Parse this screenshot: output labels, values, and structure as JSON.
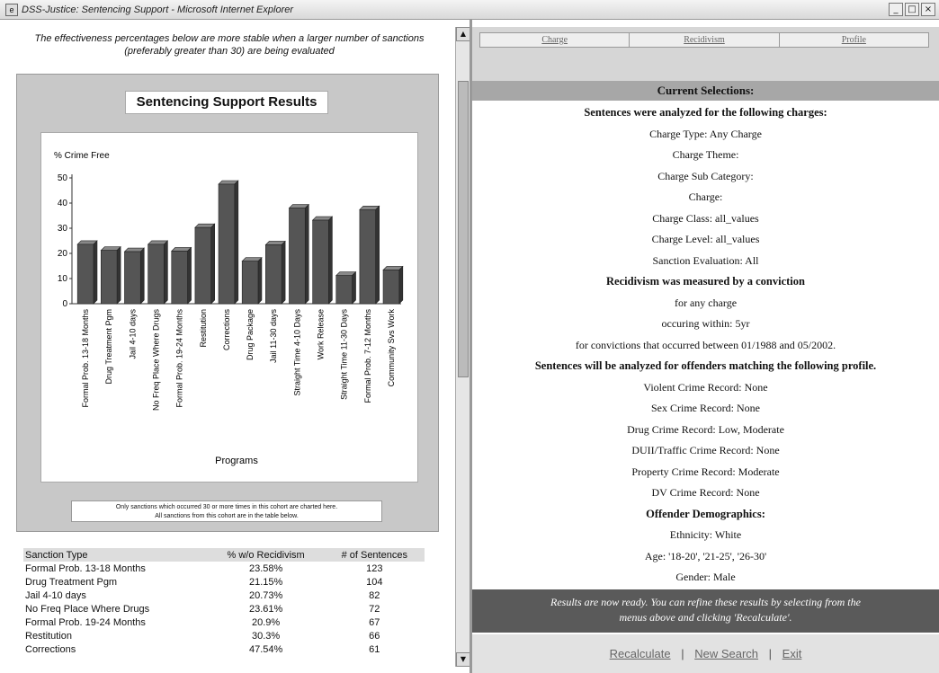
{
  "window": {
    "title": "DSS-Justice: Sentencing Support - Microsoft Internet Explorer",
    "minimize": "_",
    "restore": "□",
    "close": "×"
  },
  "left": {
    "note": "The effectiveness percentages below are more stable when a larger number of sanctions (preferably greater than 30) are being evaluated",
    "chart_footnote_line1": "Only sanctions which occurred 30 or more times in this cohort are charted here.",
    "chart_footnote_line2": "All sanctions from this cohort are in the table below."
  },
  "chart_data": {
    "type": "bar",
    "title": "Sentencing Support Results",
    "ylabel": "% Crime Free",
    "xlabel": "Programs",
    "ylim": [
      0,
      50
    ],
    "yticks": [
      0,
      10,
      20,
      30,
      40,
      50
    ],
    "grid": false,
    "categories": [
      "Formal Prob. 13-18 Months",
      "Drug Treatment Pgm",
      "Jail 4-10 days",
      "No Freq Place Where Drugs",
      "Formal Prob. 19-24 Months",
      "Restitution",
      "Corrections",
      "Drug Package",
      "Jail 11-30 days",
      "Straight Time 4-10 Days",
      "Work Release",
      "Straight Time 11-30 Days",
      "Formal Prob. 7-12 Months",
      "Community Svs Work"
    ],
    "values": [
      23.6,
      21.2,
      20.7,
      23.6,
      20.9,
      30.3,
      47.5,
      16.9,
      23.4,
      38.0,
      33.2,
      11.2,
      37.4,
      13.4
    ],
    "bar_color": "#555555"
  },
  "table": {
    "headers": [
      "Sanction Type",
      "% w/o Recidivism",
      "# of Sentences"
    ],
    "rows": [
      [
        "Formal Prob. 13-18 Months",
        "23.58%",
        "123"
      ],
      [
        "Drug Treatment Pgm",
        "21.15%",
        "104"
      ],
      [
        "Jail 4-10 days",
        "20.73%",
        "82"
      ],
      [
        "No Freq Place Where Drugs",
        "23.61%",
        "72"
      ],
      [
        "Formal Prob. 19-24 Months",
        "20.9%",
        "67"
      ],
      [
        "Restitution",
        "30.3%",
        "66"
      ],
      [
        "Corrections",
        "47.54%",
        "61"
      ]
    ]
  },
  "right": {
    "tabs": [
      "Charge",
      "Recidivism",
      "Profile"
    ],
    "header": "Current Selections:",
    "lines": [
      {
        "text": "Sentences were analyzed for the following charges:",
        "bold": true
      },
      {
        "text": "Charge Type: Any Charge",
        "bold": false
      },
      {
        "text": "Charge Theme:",
        "bold": false
      },
      {
        "text": "Charge Sub Category:",
        "bold": false
      },
      {
        "text": "Charge:",
        "bold": false
      },
      {
        "text": "Charge Class: all_values",
        "bold": false
      },
      {
        "text": "Charge Level: all_values",
        "bold": false
      },
      {
        "text": "Sanction Evaluation: All",
        "bold": false
      },
      {
        "text": "Recidivism was measured by a conviction",
        "bold": true
      },
      {
        "text": "for any charge",
        "bold": false
      },
      {
        "text": "occuring within: 5yr",
        "bold": false
      },
      {
        "text": "for convictions that occurred between 01/1988 and 05/2002.",
        "bold": false
      },
      {
        "text": "Sentences will be analyzed for offenders matching the following profile.",
        "bold": true
      },
      {
        "text": "Violent Crime Record: None",
        "bold": false
      },
      {
        "text": "Sex Crime Record: None",
        "bold": false
      },
      {
        "text": "Drug Crime Record: Low, Moderate",
        "bold": false
      },
      {
        "text": "DUII/Traffic Crime Record: None",
        "bold": false
      },
      {
        "text": "Property Crime Record: Moderate",
        "bold": false
      },
      {
        "text": "DV Crime Record: None",
        "bold": false
      },
      {
        "text": "Offender Demographics:",
        "bold": true
      },
      {
        "text": "Ethnicity: White",
        "bold": false
      },
      {
        "text": "Age: '18-20', '21-25', '26-30'",
        "bold": false
      },
      {
        "text": "Gender: Male",
        "bold": false
      }
    ],
    "ready_line1": "Results are now ready. You can refine these results by selecting from the",
    "ready_line2": "menus above and clicking 'Recalculate'.",
    "footer": {
      "recalculate": "Recalculate",
      "new_search": "New Search",
      "exit": "Exit",
      "separator": "|"
    }
  }
}
